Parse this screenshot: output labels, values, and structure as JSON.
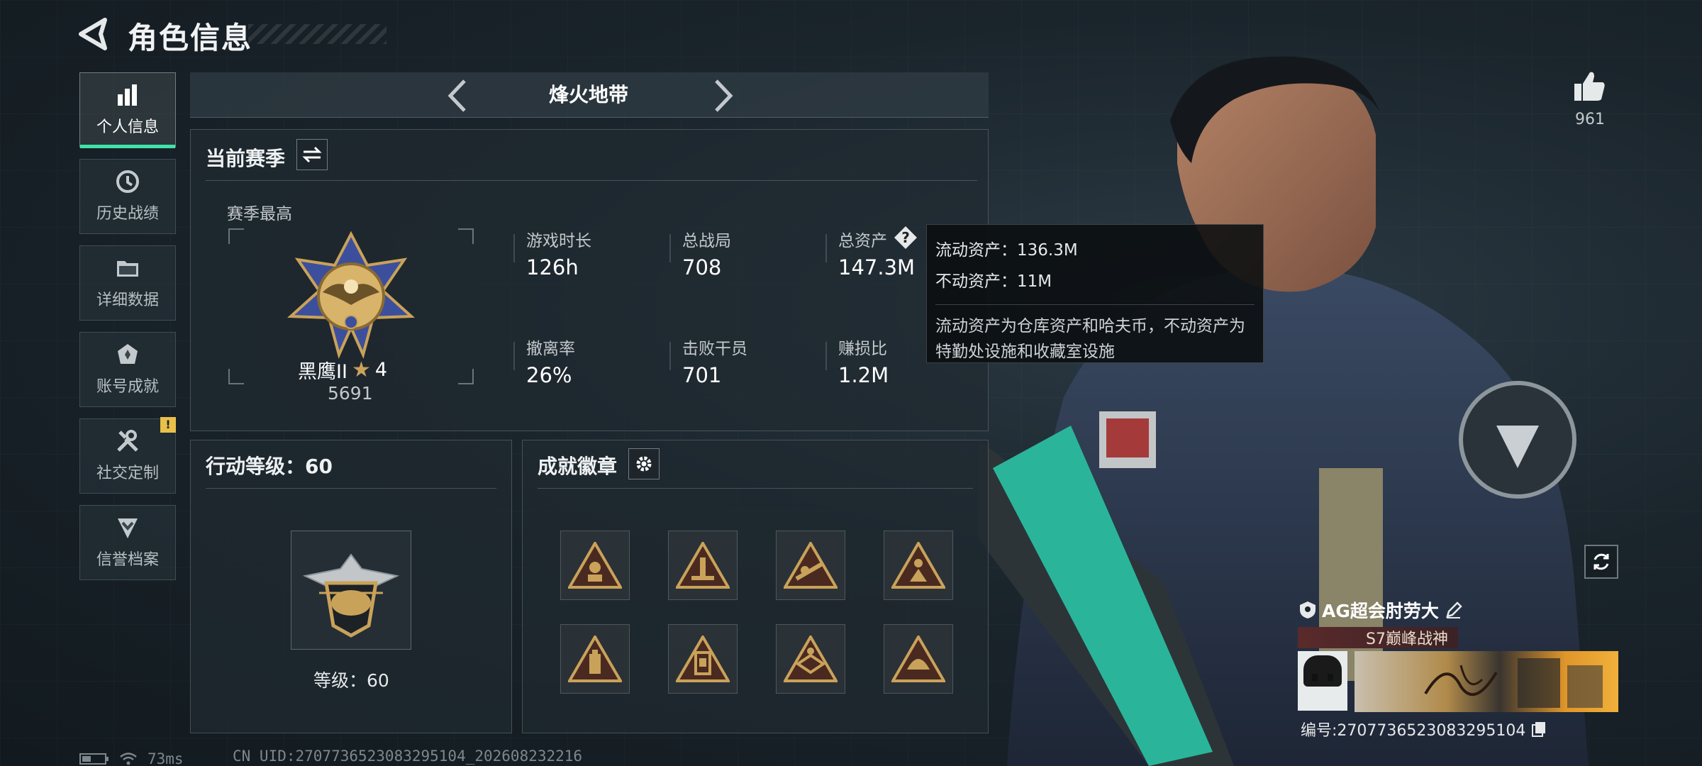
{
  "header": {
    "title": "角色信息"
  },
  "nav": [
    {
      "label": "个人信息",
      "icon": "bar-chart-icon",
      "active": true
    },
    {
      "label": "历史战绩",
      "icon": "history-clock-icon",
      "active": false
    },
    {
      "label": "详细数据",
      "icon": "folder-icon",
      "active": false
    },
    {
      "label": "账号成就",
      "icon": "achievement-icon",
      "active": false
    },
    {
      "label": "社交定制",
      "icon": "tools-icon",
      "active": false,
      "alert": "!"
    },
    {
      "label": "信誉档案",
      "icon": "shield-chevron-icon",
      "active": false
    }
  ],
  "mode": {
    "title": "烽火地带"
  },
  "season": {
    "title": "当前赛季",
    "best_label": "赛季最高",
    "rank_name": "黑鹰II",
    "rank_stars": "4",
    "rank_score": "5691",
    "stats": [
      {
        "label": "游戏时长",
        "value": "126h"
      },
      {
        "label": "总战局",
        "value": "708"
      },
      {
        "label": "总资产",
        "value": "147.3M"
      },
      {
        "label": "撤离率",
        "value": "26%"
      },
      {
        "label": "击败干员",
        "value": "701"
      },
      {
        "label": "赚损比",
        "value": "1.2M"
      }
    ]
  },
  "tooltip": {
    "line1": "流动资产：136.3M",
    "line2": "不动资产：11M",
    "desc": "流动资产为仓库资产和哈夫币，不动资产为特勤处设施和收藏室设施"
  },
  "action_level": {
    "title": "行动等级：60",
    "level_label": "等级：60"
  },
  "badges": {
    "title": "成就徽章",
    "items": [
      "badge-1",
      "badge-2",
      "badge-3",
      "badge-4",
      "badge-5",
      "badge-6",
      "badge-7",
      "badge-8"
    ]
  },
  "profile": {
    "likes": "961",
    "name": "AG超会肘劳大",
    "title_tag": "S7巅峰战神",
    "id_text": "编号:2707736523083295104"
  },
  "status_bar": {
    "ping": "73ms",
    "uid": "CN UID:2707736523083295104_202608232216"
  },
  "colors": {
    "accent": "#3fe3a8",
    "gold": "#c9a25a",
    "alert": "#e8c14a"
  }
}
